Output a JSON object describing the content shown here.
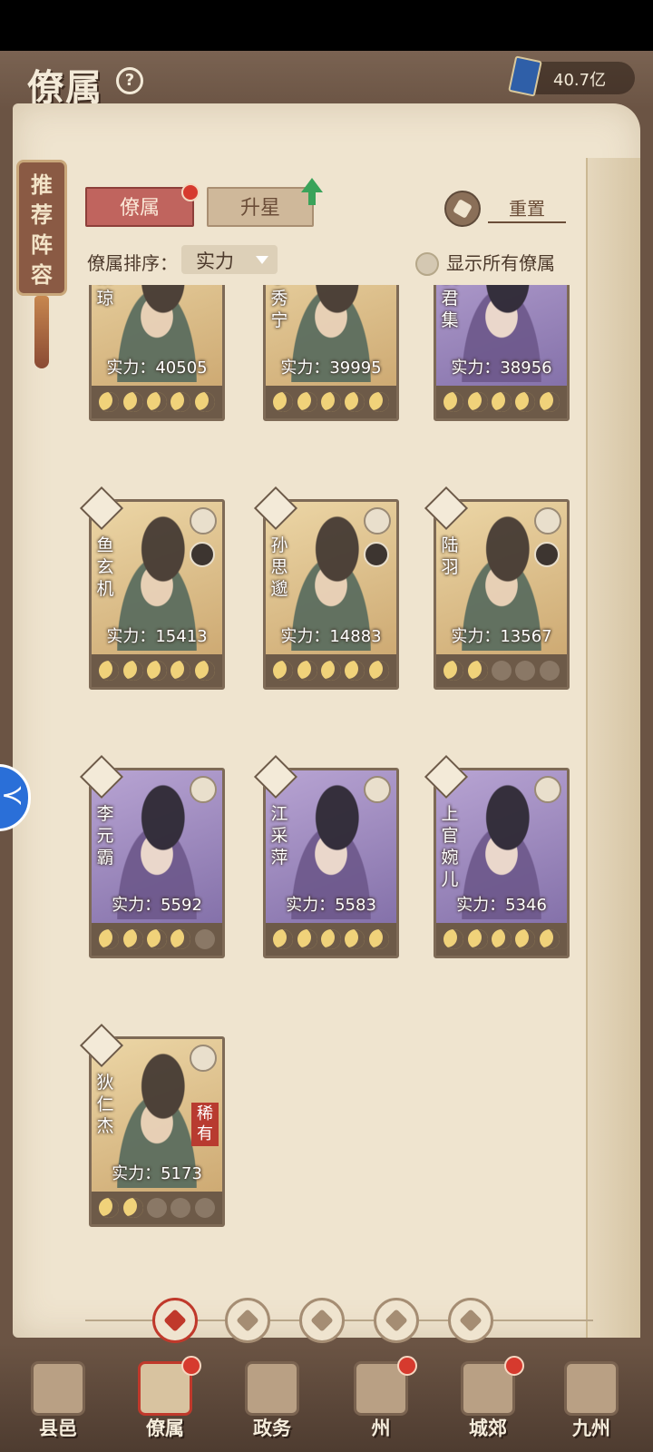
{
  "header": {
    "title": "僚属",
    "currency_value": "40.7亿"
  },
  "side_tag": {
    "label": "推荐阵容"
  },
  "tabs": [
    {
      "label": "僚属",
      "active": true,
      "has_dot": true
    },
    {
      "label": "升星",
      "active": false,
      "has_arrow": true
    }
  ],
  "reset": {
    "label": "重置"
  },
  "sort": {
    "label": "僚属排序：",
    "value": "实力"
  },
  "filter": {
    "label": "显示所有僚属"
  },
  "cards": [
    {
      "name": "秦琼",
      "power": "实力：40505",
      "frame": "gold",
      "stars": 5,
      "max_stars": 5
    },
    {
      "name": "李秀宁",
      "power": "实力：39995",
      "frame": "gold",
      "stars": 5,
      "max_stars": 5
    },
    {
      "name": "侯君集",
      "power": "实力：38956",
      "frame": "purple",
      "stars": 5,
      "max_stars": 5
    },
    {
      "name": "鱼玄机",
      "power": "实力：15413",
      "frame": "gold",
      "stars": 5,
      "max_stars": 5
    },
    {
      "name": "孙思邈",
      "power": "实力：14883",
      "frame": "gold",
      "stars": 5,
      "max_stars": 5
    },
    {
      "name": "陆羽",
      "power": "实力：13567",
      "frame": "gold",
      "stars": 2,
      "max_stars": 5
    },
    {
      "name": "李元霸",
      "power": "实力：5592",
      "frame": "purple",
      "stars": 4,
      "max_stars": 5
    },
    {
      "name": "江采萍",
      "power": "实力：5583",
      "frame": "purple",
      "stars": 5,
      "max_stars": 5
    },
    {
      "name": "上官婉儿",
      "power": "实力：5346",
      "frame": "purple",
      "stars": 5,
      "max_stars": 5
    },
    {
      "name": "狄仁杰",
      "power": "实力：5173",
      "frame": "gold",
      "stars": 2,
      "max_stars": 5,
      "rare_tag": "稀有"
    }
  ],
  "category_filters": [
    {
      "icon": "all-category-icon",
      "active": true
    },
    {
      "icon": "bell-category-icon",
      "active": false
    },
    {
      "icon": "gourd-category-icon",
      "active": false
    },
    {
      "icon": "fan-category-icon",
      "active": false
    },
    {
      "icon": "lion-category-icon",
      "active": false
    }
  ],
  "bottom_nav": [
    {
      "label": "县邑",
      "has_dot": false
    },
    {
      "label": "僚属",
      "has_dot": true,
      "active": true
    },
    {
      "label": "政务",
      "has_dot": false
    },
    {
      "label": "州",
      "has_dot": true
    },
    {
      "label": "城郊",
      "has_dot": true
    },
    {
      "label": "九州",
      "has_dot": false
    }
  ],
  "colors": {
    "accent_red": "#c0392b",
    "parchment": "#efe4cf",
    "wood": "#6b5444",
    "gold_frame": "#c9a36b",
    "purple_frame": "#7c69a3"
  }
}
